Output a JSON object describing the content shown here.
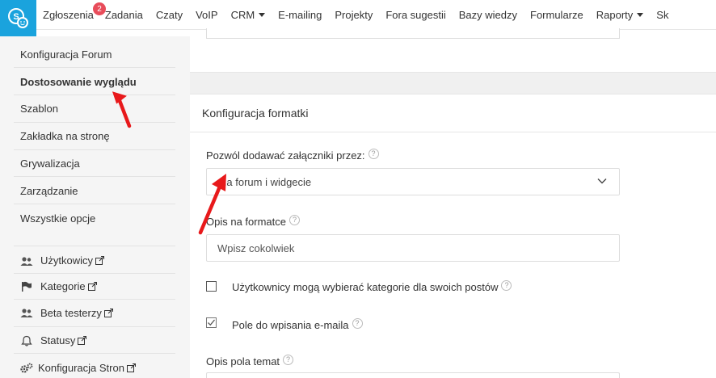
{
  "app": {
    "logo_icon": "chat-bubbles-icon",
    "accent": "#1aa3dd",
    "badge_color": "#e84c5a"
  },
  "nav": {
    "items": [
      {
        "label": "Zgłoszenia",
        "badge": "2"
      },
      {
        "label": "Zadania"
      },
      {
        "label": "Czaty"
      },
      {
        "label": "VoIP"
      },
      {
        "label": "CRM",
        "dropdown": true
      },
      {
        "label": "E-mailing"
      },
      {
        "label": "Projekty"
      },
      {
        "label": "Fora sugestii"
      },
      {
        "label": "Bazy wiedzy"
      },
      {
        "label": "Formularze"
      },
      {
        "label": "Raporty",
        "dropdown": true
      },
      {
        "label": "Sk"
      }
    ]
  },
  "sidebar": {
    "links": [
      {
        "label": "Konfiguracja Forum"
      },
      {
        "label": "Dostosowanie wyglądu",
        "active": true
      },
      {
        "label": "Szablon"
      },
      {
        "label": "Zakładka na stronę"
      },
      {
        "label": "Grywalizacja"
      },
      {
        "label": "Zarządzanie"
      },
      {
        "label": "Wszystkie opcje"
      }
    ],
    "external_links": [
      {
        "label": "Użytkowicy",
        "icon": "users-icon"
      },
      {
        "label": "Kategorie",
        "icon": "flag-icon"
      },
      {
        "label": "Beta testerzy",
        "icon": "users-icon"
      },
      {
        "label": "Statusy",
        "icon": "bell-icon"
      },
      {
        "label": "Konfiguracja Stron",
        "icon": "gears-icon"
      }
    ]
  },
  "main": {
    "section_title": "Konfiguracja formatki",
    "attachments": {
      "label": "Pozwól dodawać załączniki przez:",
      "value": "Na forum i widgecie"
    },
    "form_description": {
      "label": "Opis na formatce",
      "placeholder": "Wpisz cokolwiek"
    },
    "categories_checkbox": {
      "label": "Użytkownicy mogą wybierać kategorie dla swoich postów",
      "checked": false
    },
    "email_checkbox": {
      "label": "Pole do wpisania e-maila",
      "checked": true
    },
    "subject_description": {
      "label": "Opis pola temat"
    },
    "help_glyph": "?"
  }
}
